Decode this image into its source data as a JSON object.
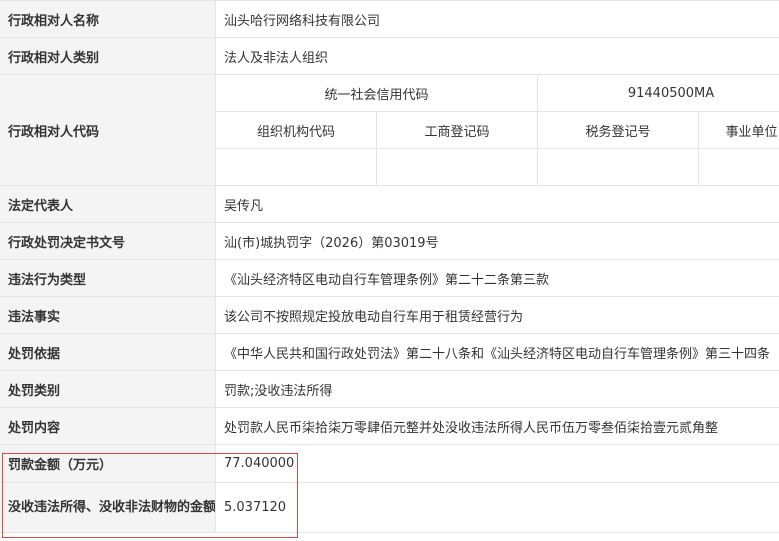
{
  "rows": {
    "name": {
      "label": "行政相对人名称",
      "value": "汕头哈行网络科技有限公司"
    },
    "category": {
      "label": "行政相对人类别",
      "value": "法人及非法人组织"
    },
    "code": {
      "label": "行政相对人代码",
      "credit_code_label": "统一社会信用代码",
      "credit_code_value": "91440500MA",
      "org_code_label": "组织机构代码",
      "business_reg_label": "工商登记码",
      "tax_reg_label": "税务登记号",
      "institution_label": "事业单位"
    },
    "legal_rep": {
      "label": "法定代表人",
      "value": "吴传凡"
    },
    "decision_no": {
      "label": "行政处罚决定书文号",
      "value": "汕(市)城执罚字（2026）第03019号"
    },
    "violation_type": {
      "label": "违法行为类型",
      "value": "《汕头经济特区电动自行车管理条例》第二十二条第三款"
    },
    "facts": {
      "label": "违法事实",
      "value": "该公司不按照规定投放电动自行车用于租赁经营行为"
    },
    "basis": {
      "label": "处罚依据",
      "value": "《中华人民共和国行政处罚法》第二十八条和《汕头经济特区电动自行车管理条例》第三十四条"
    },
    "penalty_type": {
      "label": "处罚类别",
      "value": "罚款;没收违法所得"
    },
    "content": {
      "label": "处罚内容",
      "value": "处罚款人民币柒拾柒万零肆佰元整并处没收违法所得人民币伍万零叁佰柒拾壹元贰角整"
    },
    "fine": {
      "label": "罚款金额（万元）",
      "value": "77.040000"
    },
    "confiscation": {
      "label": "没收违法所得、没收非法财物的金额（万元）",
      "value": "5.037120"
    }
  },
  "highlight_color": "#e04848"
}
